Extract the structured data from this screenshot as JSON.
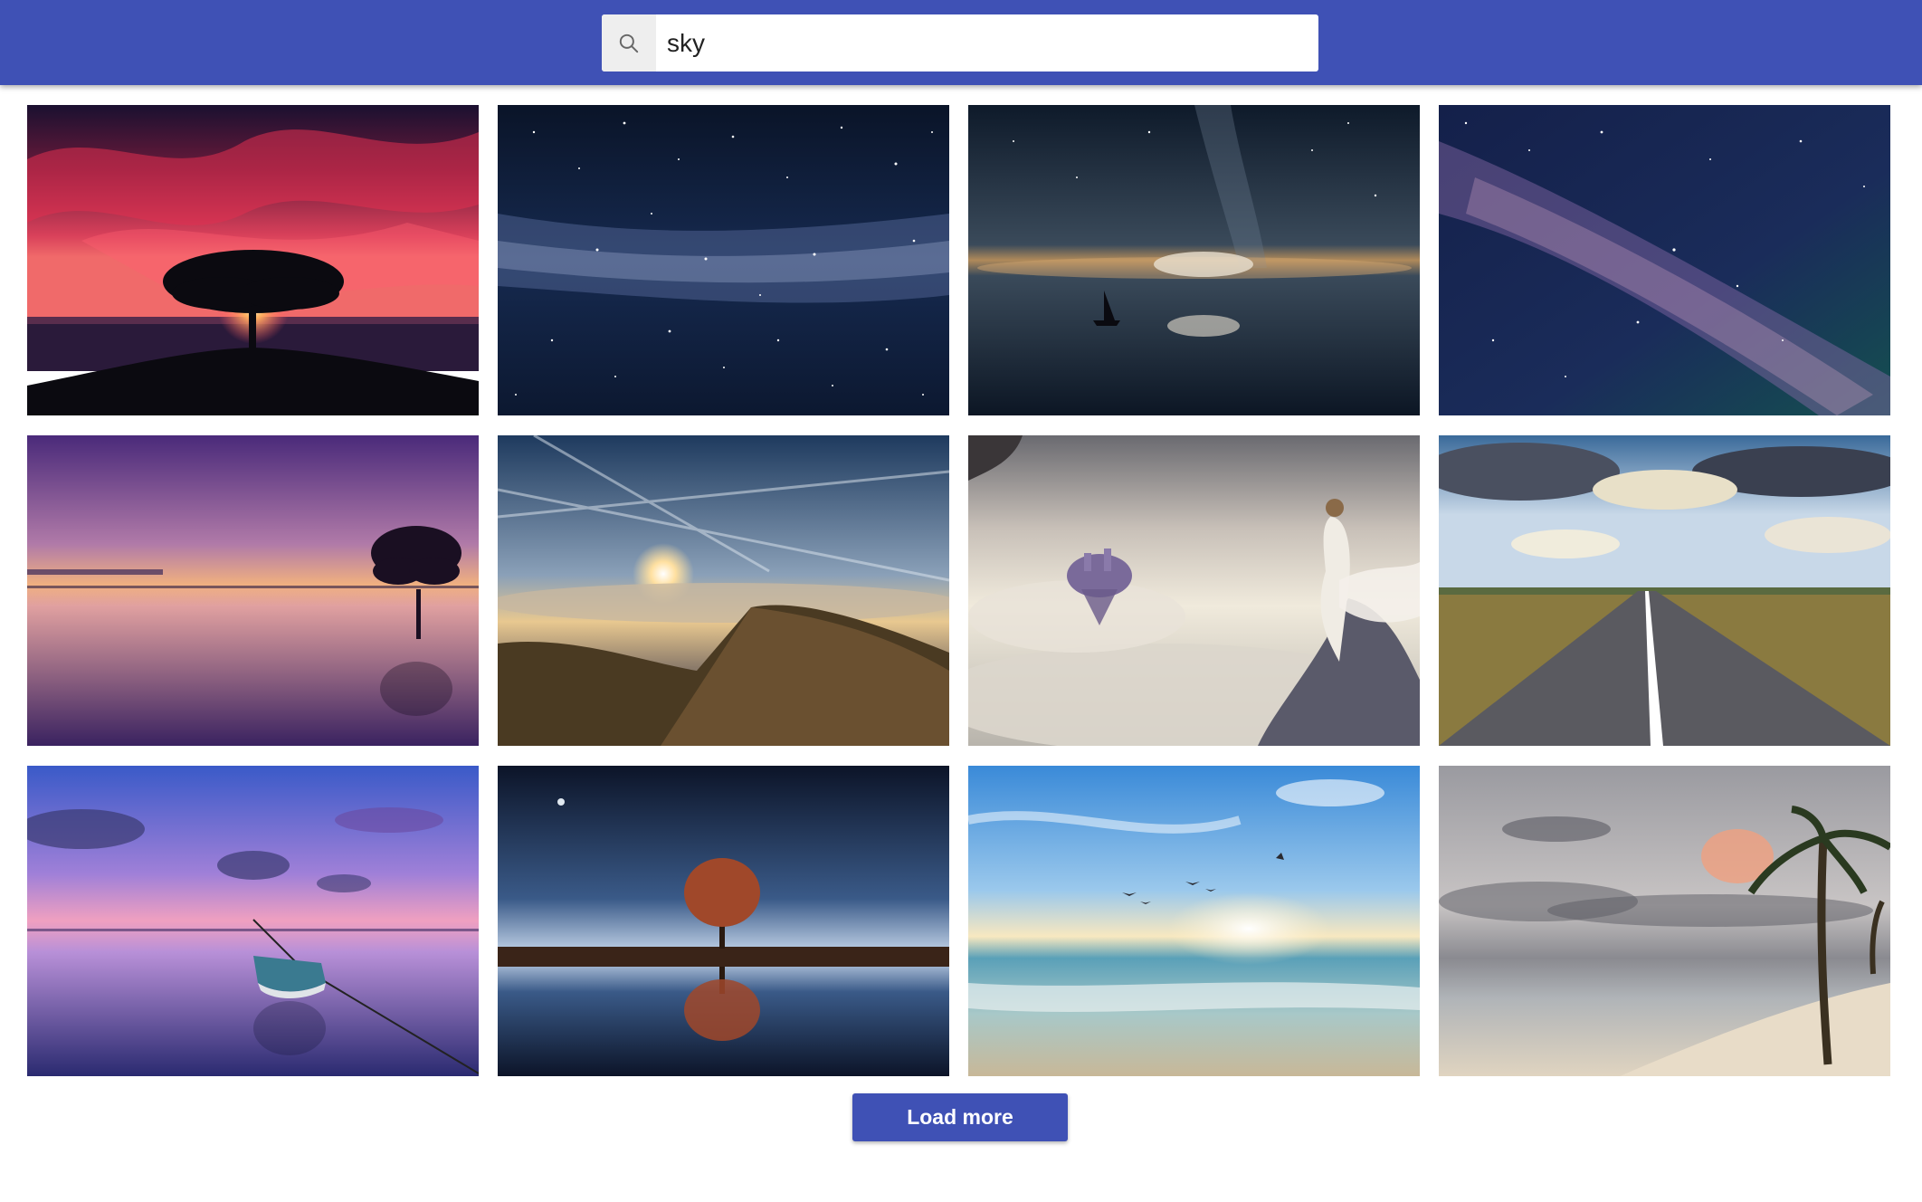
{
  "search": {
    "value": "sky",
    "icon": "search-icon"
  },
  "gallery": {
    "columns": 4,
    "photos": [
      {
        "subject": "tree-sunset-red-clouds-photo"
      },
      {
        "subject": "milky-way-starfield-photo"
      },
      {
        "subject": "sailboat-night-reflection-photo"
      },
      {
        "subject": "galaxy-nebula-photo"
      },
      {
        "subject": "purple-dusk-tree-lake-photo"
      },
      {
        "subject": "mountain-sunrise-clouds-photo"
      },
      {
        "subject": "woman-floating-castle-photo"
      },
      {
        "subject": "road-to-horizon-photo"
      },
      {
        "subject": "rowboat-pink-sunset-photo"
      },
      {
        "subject": "tree-night-reflection-photo"
      },
      {
        "subject": "beach-sunrise-birds-photo"
      },
      {
        "subject": "palm-beach-stormy-sky-photo"
      }
    ]
  },
  "load_more": {
    "label": "Load more"
  },
  "colors": {
    "primary": "#3f51b5",
    "search_icon_bg": "#eeeeee"
  }
}
